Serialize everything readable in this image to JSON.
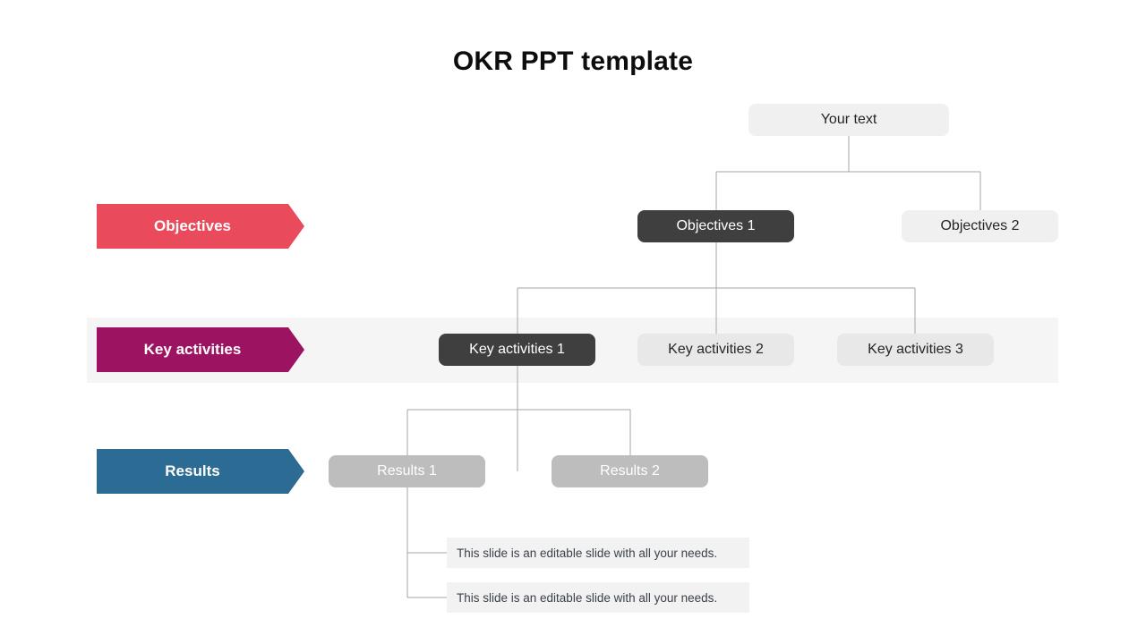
{
  "slide": {
    "title": "OKR PPT template"
  },
  "root": {
    "label": "Your text"
  },
  "categories": [
    {
      "key": "objectives",
      "label": "Objectives",
      "color": "#e94b5c"
    },
    {
      "key": "key_activities",
      "label": "Key activities",
      "color": "#9b1361"
    },
    {
      "key": "results",
      "label": "Results",
      "color": "#2c6b94"
    }
  ],
  "rows": {
    "objectives": {
      "nodes": [
        {
          "label": "Objectives 1",
          "state": "selected"
        },
        {
          "label": "Objectives 2",
          "state": "default"
        }
      ]
    },
    "key_activities": {
      "nodes": [
        {
          "label": "Key activities 1",
          "state": "selected"
        },
        {
          "label": "Key activities 2",
          "state": "default"
        },
        {
          "label": "Key activities 3",
          "state": "default"
        }
      ]
    },
    "results": {
      "nodes": [
        {
          "label": "Results 1",
          "state": "default"
        },
        {
          "label": "Results 2",
          "state": "default"
        }
      ]
    }
  },
  "notes": [
    {
      "text": "This slide is an editable slide with all your needs."
    },
    {
      "text": "This slide is an editable slide with all your needs."
    }
  ],
  "colors": {
    "background": "#ffffff",
    "band": "#f5f5f5",
    "connector": "#a6a6a6",
    "node_light": "#f0f0f0",
    "node_dark": "#3f3f3f",
    "node_gray": "#e8e8e8",
    "node_solid_gray": "#bdbdbd",
    "note_bg": "#f2f2f2",
    "title_text": "#0d0d0d"
  }
}
